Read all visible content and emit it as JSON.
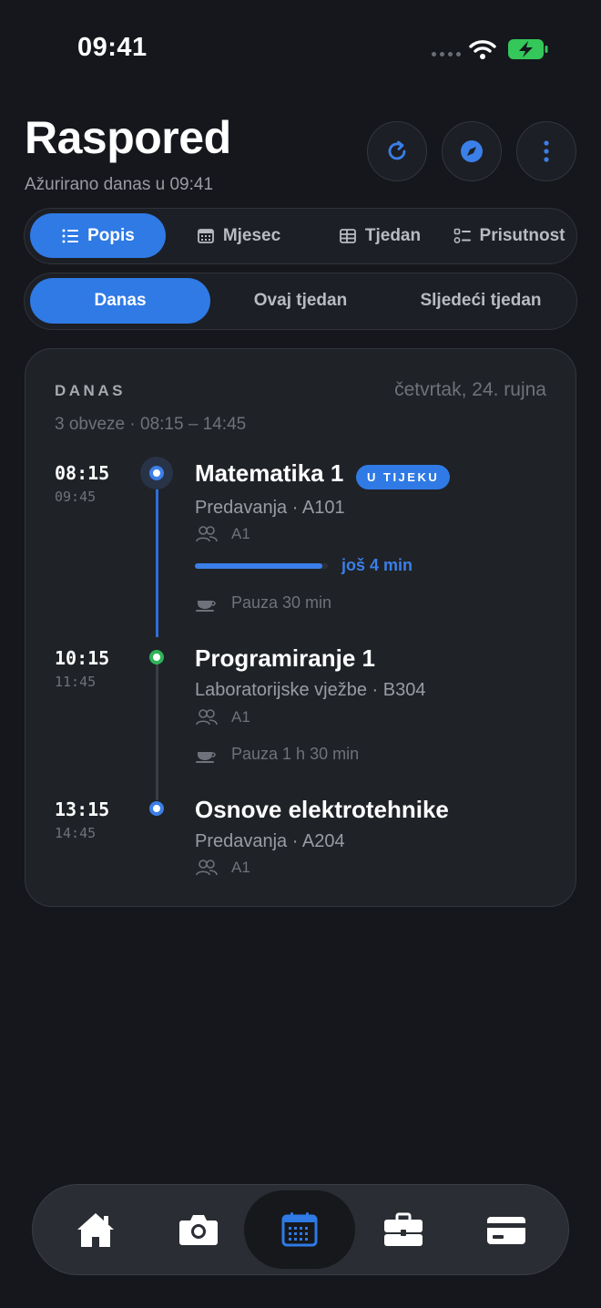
{
  "status_bar": {
    "time": "09:41"
  },
  "header": {
    "title": "Raspored",
    "subtitle": "Ažurirano danas u 09:41"
  },
  "view_tabs": [
    {
      "label": "Popis",
      "icon": "list-icon",
      "active": true
    },
    {
      "label": "Mjesec",
      "icon": "calendar-grid-icon",
      "active": false
    },
    {
      "label": "Tjedan",
      "icon": "table-icon",
      "active": false
    },
    {
      "label": "Prisutnost",
      "icon": "checklist-icon",
      "active": false
    }
  ],
  "range_tabs": [
    {
      "label": "Danas",
      "active": true
    },
    {
      "label": "Ovaj tjedan",
      "active": false
    },
    {
      "label": "Sljedeći tjedan",
      "active": false
    }
  ],
  "day_card": {
    "label": "DANAS",
    "date": "četvrtak, 24. rujna",
    "summary": "3 obveze · 08:15 – 14:45",
    "events": [
      {
        "start": "08:15",
        "end": "09:45",
        "title": "Matematika 1",
        "badge": "U TIJEKU",
        "subtitle": "Predavanja · A101",
        "group": "A1",
        "progress_fraction": 0.96,
        "progress_text": "još 4 min",
        "break_after": "Pauza 30 min",
        "dot_color": "#3b7fe8"
      },
      {
        "start": "10:15",
        "end": "11:45",
        "title": "Programiranje 1",
        "subtitle": "Laboratorijske vježbe · B304",
        "group": "A1",
        "break_after": "Pauza 1 h 30 min",
        "dot_color": "#2fb35a"
      },
      {
        "start": "13:15",
        "end": "14:45",
        "title": "Osnove elektrotehnike",
        "subtitle": "Predavanja · A204",
        "group": "A1",
        "dot_color": "#3b7fe8"
      }
    ]
  },
  "tab_bar": [
    {
      "icon": "home-icon",
      "active": false
    },
    {
      "icon": "camera-icon",
      "active": false
    },
    {
      "icon": "calendar-icon",
      "active": true
    },
    {
      "icon": "briefcase-icon",
      "active": false
    },
    {
      "icon": "card-icon",
      "active": false
    }
  ],
  "colors": {
    "accent": "#2f7ae5",
    "background": "#15171c",
    "card": "#1f2227",
    "lab_dot": "#2fb35a",
    "battery": "#34c759"
  }
}
